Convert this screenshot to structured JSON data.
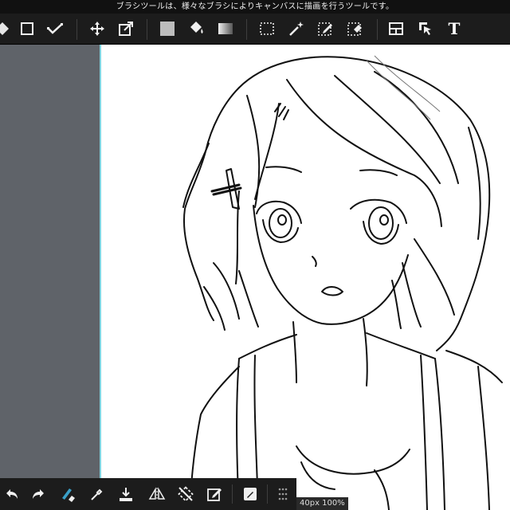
{
  "hint_text": "ブラシツールは、様々なブラシによりキャンバスに描画を行うツールです。",
  "toolbar": {
    "tools": [
      {
        "icon": "tool-menu-icon"
      },
      {
        "icon": "rect-select-icon"
      },
      {
        "icon": "vector-check-icon"
      },
      {
        "icon": "move-icon"
      },
      {
        "icon": "transform-icon"
      },
      {
        "icon": "fill-color-icon"
      },
      {
        "icon": "bucket-fill-icon"
      },
      {
        "icon": "gradient-icon"
      },
      {
        "icon": "select-dashed-icon"
      },
      {
        "icon": "magic-wand-icon"
      },
      {
        "icon": "select-pen-icon"
      },
      {
        "icon": "select-eraser-icon"
      },
      {
        "icon": "frame-divider-icon"
      },
      {
        "icon": "operation-icon"
      },
      {
        "icon": "text-tool-icon"
      }
    ],
    "text_tool_label": "T"
  },
  "bottom_toolbar": {
    "tools": [
      {
        "icon": "undo-icon"
      },
      {
        "icon": "redo-icon"
      },
      {
        "icon": "brush-eraser-toggle-icon"
      },
      {
        "icon": "eyedropper-icon"
      },
      {
        "icon": "download-icon"
      },
      {
        "icon": "flip-horizontal-icon"
      },
      {
        "icon": "rotate-reset-icon"
      },
      {
        "icon": "edit-shortcut-icon"
      },
      {
        "icon": "pen-square-icon"
      },
      {
        "icon": "grid-dots-icon"
      }
    ]
  },
  "status": {
    "readout": "40px 100%"
  },
  "colors": {
    "toolbar_bg": "#1c1c1c",
    "side_panel": "#5f6369",
    "canvas": "#ffffff",
    "accent": "#7fd3df"
  }
}
